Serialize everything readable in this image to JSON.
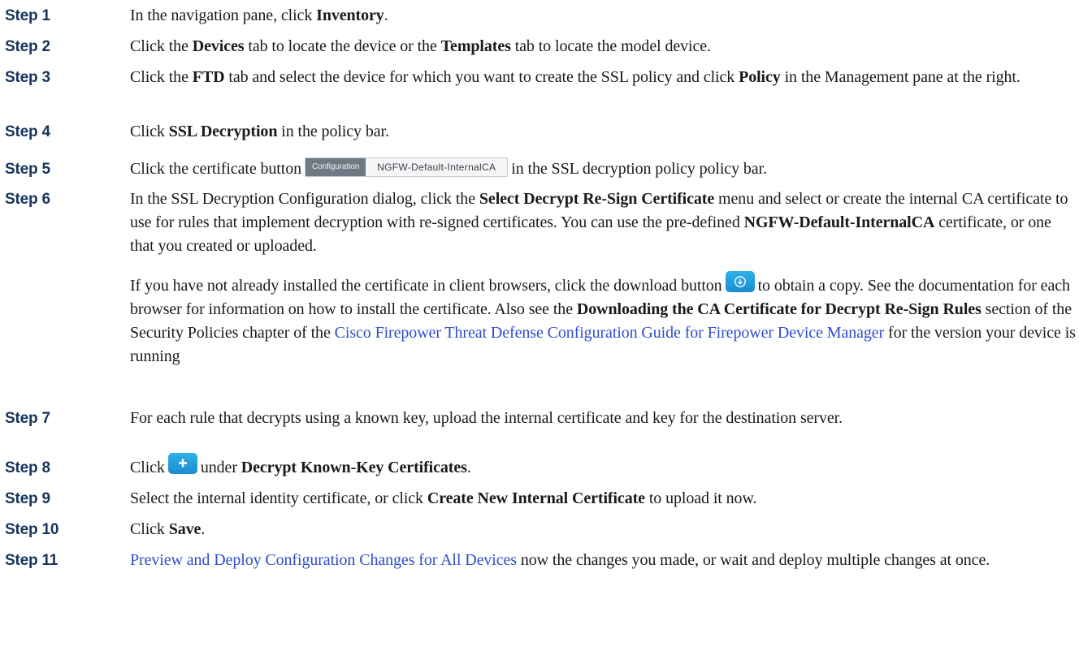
{
  "steps": [
    {
      "label": "Step 1",
      "t1": "In the navigation pane, click ",
      "b1": "Inventory",
      "t2": "."
    },
    {
      "label": "Step 2",
      "t1": "Click the ",
      "b1": "Devices",
      "t2": " tab to locate the device or the ",
      "b2": "Templates",
      "t3": " tab to locate the model device."
    },
    {
      "label": "Step 3",
      "t1": "Click the ",
      "b1": "FTD",
      "t2": " tab and select the device for which you want to create the SSL policy and click ",
      "b2": "Policy",
      "t3": " in the Management pane at the right."
    },
    {
      "label": "Step 4",
      "t1": "Click ",
      "b1": "SSL Decryption",
      "t2": " in the policy bar."
    },
    {
      "label": "Step 5",
      "t1": "Click the certificate button",
      "t2": "in the SSL decryption policy policy bar."
    },
    {
      "label": "Step 6",
      "t1": "In the SSL Decryption Configuration dialog, click the ",
      "b1": "Select Decrypt Re-Sign Certificate",
      "t2": " menu and select or create the internal CA certificate to use for rules that implement decryption with re-signed certificates. You can use the pre-defined ",
      "b2": "NGFW-Default-InternalCA",
      "t3": " certificate, or one that you created or uploaded.",
      "p2_t1": "If you have not already installed the certificate in client browsers, click the download button",
      "p2_t2": "to obtain a copy. See the documentation for each browser for information on how to install the certificate. Also see the ",
      "p2_b1": "Downloading the CA Certificate for Decrypt Re-Sign Rules",
      "p2_t3": " section of the Security Policies chapter of the ",
      "p2_link": "Cisco Firepower Threat Defense Configuration Guide for Firepower Device Manager",
      "p2_t4": " for the version your device is running"
    },
    {
      "label": "Step 7",
      "t1": "For each rule that decrypts using a known key, upload the internal certificate and key for the destination server."
    },
    {
      "label": "Step 8",
      "t1": "Click",
      "t2": "under ",
      "b1": "Decrypt Known-Key Certificates",
      "t3": "."
    },
    {
      "label": "Step 9",
      "t1": "Select the internal identity certificate, or click ",
      "b1": "Create New Internal Certificate",
      "t2": " to upload it now."
    },
    {
      "label": "Step 10",
      "t1": "Click ",
      "b1": "Save",
      "t2": "."
    },
    {
      "label": "Step 11",
      "link": "Preview and Deploy Configuration Changes for All Devices",
      "t1": " now the changes you made, or wait and deploy multiple changes at once."
    }
  ],
  "config_button": {
    "tag": "Configuration",
    "value": "NGFW-Default-InternalCA"
  },
  "icons": {
    "download": "download-icon",
    "add": "plus-icon"
  },
  "colors": {
    "link": "#2d4ec9",
    "step_label": "#16345c",
    "icon_button": "#1e9ad8"
  }
}
